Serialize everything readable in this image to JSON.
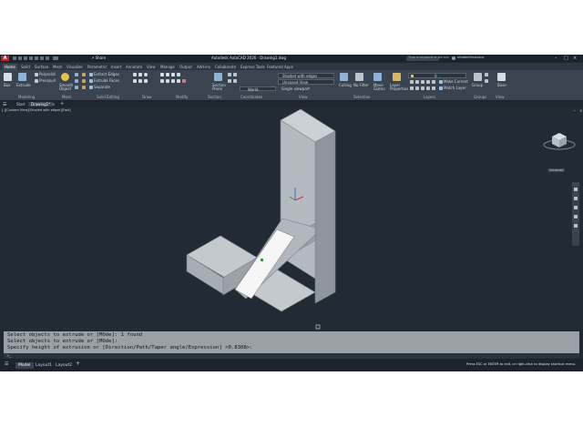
{
  "app": {
    "title": "Autodesk AutoCAD 2026 - Drawing1.dwg",
    "share_label": "Share",
    "search_placeholder": "Type a keyword or phrase",
    "user": "elizabethnolasco",
    "logo_letter": "A"
  },
  "ribbon": {
    "tabs": [
      "Home",
      "Solid",
      "Surface",
      "Mesh",
      "Visualize",
      "Parametric",
      "Insert",
      "Annotate",
      "View",
      "Manage",
      "Output",
      "Add-ins",
      "Collaborate",
      "Express Tools",
      "Featured Apps"
    ],
    "active_tab": "Home",
    "panels": [
      "Modeling",
      "Mesh",
      "Solid Editing",
      "Draw",
      "Modify",
      "Section",
      "Coordinates",
      "View",
      "Selection",
      "Layers",
      "Groups",
      "View"
    ],
    "buttons": {
      "box": "Box",
      "extrude": "Extrude",
      "polysolid": "Polysolid",
      "presspull": "Presspull",
      "smooth_object": "Smooth\nObject",
      "extract_edges": "Extract Edges",
      "extrude_faces": "Extrude Faces",
      "separate": "Separate",
      "section_plane": "Section\nPlane",
      "visual_style": "Shaded with edges",
      "unsaved_view": "Unsaved View",
      "world": "World",
      "single_viewport": "Single viewport",
      "culling": "Culling",
      "no_filter": "No Filter",
      "move_gizmo": "Move\nGizmo",
      "layer_properties": "Layer\nProperties",
      "layer_value": "0",
      "make_current": "Make Current",
      "match_layer": "Match Layer",
      "group": "Group",
      "base": "Base"
    }
  },
  "documents": {
    "tabs": [
      "Start",
      "Drawing1*"
    ],
    "active": "Drawing1*",
    "add_label": "+"
  },
  "viewport": {
    "label": "[-][Custom View][Shaded with edges][Fast]",
    "viewcube_label": "Unnamed"
  },
  "command": {
    "history": [
      "Select objects to extrude or [MOde]: 1 found",
      "Select objects to extrude or [MOde]:",
      "Specify height of extrusion or [Direction/Path/Taper angle/Expression] <0.8308>:"
    ],
    "prompt_icon": ">_"
  },
  "status": {
    "layout_tabs": [
      "Model",
      "Layout1",
      "Layout2"
    ],
    "active_layout": "Model",
    "add_label": "+",
    "hint": "Press ESC or ENTER to exit, or right-click to display shortcut menu."
  },
  "colors": {
    "viewport_bg": "#222a33",
    "ribbon_bg": "#3a4350",
    "solid_face_light": "#bec3c8",
    "solid_face_mid": "#a7adb3",
    "solid_face_dark": "#8e959c",
    "highlight_face": "#f6f6f6",
    "command_bg": "#9aa0a6",
    "logo_red": "#c8202a"
  }
}
